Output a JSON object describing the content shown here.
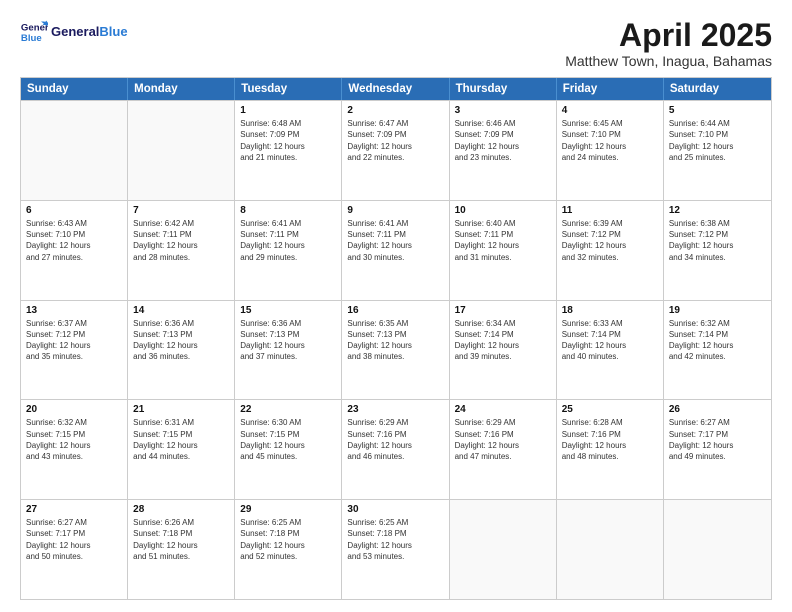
{
  "header": {
    "logo_line1": "General",
    "logo_line2": "Blue",
    "title": "April 2025",
    "subtitle": "Matthew Town, Inagua, Bahamas"
  },
  "days_of_week": [
    "Sunday",
    "Monday",
    "Tuesday",
    "Wednesday",
    "Thursday",
    "Friday",
    "Saturday"
  ],
  "weeks": [
    [
      {
        "day": "",
        "lines": []
      },
      {
        "day": "",
        "lines": []
      },
      {
        "day": "1",
        "lines": [
          "Sunrise: 6:48 AM",
          "Sunset: 7:09 PM",
          "Daylight: 12 hours",
          "and 21 minutes."
        ]
      },
      {
        "day": "2",
        "lines": [
          "Sunrise: 6:47 AM",
          "Sunset: 7:09 PM",
          "Daylight: 12 hours",
          "and 22 minutes."
        ]
      },
      {
        "day": "3",
        "lines": [
          "Sunrise: 6:46 AM",
          "Sunset: 7:09 PM",
          "Daylight: 12 hours",
          "and 23 minutes."
        ]
      },
      {
        "day": "4",
        "lines": [
          "Sunrise: 6:45 AM",
          "Sunset: 7:10 PM",
          "Daylight: 12 hours",
          "and 24 minutes."
        ]
      },
      {
        "day": "5",
        "lines": [
          "Sunrise: 6:44 AM",
          "Sunset: 7:10 PM",
          "Daylight: 12 hours",
          "and 25 minutes."
        ]
      }
    ],
    [
      {
        "day": "6",
        "lines": [
          "Sunrise: 6:43 AM",
          "Sunset: 7:10 PM",
          "Daylight: 12 hours",
          "and 27 minutes."
        ]
      },
      {
        "day": "7",
        "lines": [
          "Sunrise: 6:42 AM",
          "Sunset: 7:11 PM",
          "Daylight: 12 hours",
          "and 28 minutes."
        ]
      },
      {
        "day": "8",
        "lines": [
          "Sunrise: 6:41 AM",
          "Sunset: 7:11 PM",
          "Daylight: 12 hours",
          "and 29 minutes."
        ]
      },
      {
        "day": "9",
        "lines": [
          "Sunrise: 6:41 AM",
          "Sunset: 7:11 PM",
          "Daylight: 12 hours",
          "and 30 minutes."
        ]
      },
      {
        "day": "10",
        "lines": [
          "Sunrise: 6:40 AM",
          "Sunset: 7:11 PM",
          "Daylight: 12 hours",
          "and 31 minutes."
        ]
      },
      {
        "day": "11",
        "lines": [
          "Sunrise: 6:39 AM",
          "Sunset: 7:12 PM",
          "Daylight: 12 hours",
          "and 32 minutes."
        ]
      },
      {
        "day": "12",
        "lines": [
          "Sunrise: 6:38 AM",
          "Sunset: 7:12 PM",
          "Daylight: 12 hours",
          "and 34 minutes."
        ]
      }
    ],
    [
      {
        "day": "13",
        "lines": [
          "Sunrise: 6:37 AM",
          "Sunset: 7:12 PM",
          "Daylight: 12 hours",
          "and 35 minutes."
        ]
      },
      {
        "day": "14",
        "lines": [
          "Sunrise: 6:36 AM",
          "Sunset: 7:13 PM",
          "Daylight: 12 hours",
          "and 36 minutes."
        ]
      },
      {
        "day": "15",
        "lines": [
          "Sunrise: 6:36 AM",
          "Sunset: 7:13 PM",
          "Daylight: 12 hours",
          "and 37 minutes."
        ]
      },
      {
        "day": "16",
        "lines": [
          "Sunrise: 6:35 AM",
          "Sunset: 7:13 PM",
          "Daylight: 12 hours",
          "and 38 minutes."
        ]
      },
      {
        "day": "17",
        "lines": [
          "Sunrise: 6:34 AM",
          "Sunset: 7:14 PM",
          "Daylight: 12 hours",
          "and 39 minutes."
        ]
      },
      {
        "day": "18",
        "lines": [
          "Sunrise: 6:33 AM",
          "Sunset: 7:14 PM",
          "Daylight: 12 hours",
          "and 40 minutes."
        ]
      },
      {
        "day": "19",
        "lines": [
          "Sunrise: 6:32 AM",
          "Sunset: 7:14 PM",
          "Daylight: 12 hours",
          "and 42 minutes."
        ]
      }
    ],
    [
      {
        "day": "20",
        "lines": [
          "Sunrise: 6:32 AM",
          "Sunset: 7:15 PM",
          "Daylight: 12 hours",
          "and 43 minutes."
        ]
      },
      {
        "day": "21",
        "lines": [
          "Sunrise: 6:31 AM",
          "Sunset: 7:15 PM",
          "Daylight: 12 hours",
          "and 44 minutes."
        ]
      },
      {
        "day": "22",
        "lines": [
          "Sunrise: 6:30 AM",
          "Sunset: 7:15 PM",
          "Daylight: 12 hours",
          "and 45 minutes."
        ]
      },
      {
        "day": "23",
        "lines": [
          "Sunrise: 6:29 AM",
          "Sunset: 7:16 PM",
          "Daylight: 12 hours",
          "and 46 minutes."
        ]
      },
      {
        "day": "24",
        "lines": [
          "Sunrise: 6:29 AM",
          "Sunset: 7:16 PM",
          "Daylight: 12 hours",
          "and 47 minutes."
        ]
      },
      {
        "day": "25",
        "lines": [
          "Sunrise: 6:28 AM",
          "Sunset: 7:16 PM",
          "Daylight: 12 hours",
          "and 48 minutes."
        ]
      },
      {
        "day": "26",
        "lines": [
          "Sunrise: 6:27 AM",
          "Sunset: 7:17 PM",
          "Daylight: 12 hours",
          "and 49 minutes."
        ]
      }
    ],
    [
      {
        "day": "27",
        "lines": [
          "Sunrise: 6:27 AM",
          "Sunset: 7:17 PM",
          "Daylight: 12 hours",
          "and 50 minutes."
        ]
      },
      {
        "day": "28",
        "lines": [
          "Sunrise: 6:26 AM",
          "Sunset: 7:18 PM",
          "Daylight: 12 hours",
          "and 51 minutes."
        ]
      },
      {
        "day": "29",
        "lines": [
          "Sunrise: 6:25 AM",
          "Sunset: 7:18 PM",
          "Daylight: 12 hours",
          "and 52 minutes."
        ]
      },
      {
        "day": "30",
        "lines": [
          "Sunrise: 6:25 AM",
          "Sunset: 7:18 PM",
          "Daylight: 12 hours",
          "and 53 minutes."
        ]
      },
      {
        "day": "",
        "lines": []
      },
      {
        "day": "",
        "lines": []
      },
      {
        "day": "",
        "lines": []
      }
    ]
  ]
}
